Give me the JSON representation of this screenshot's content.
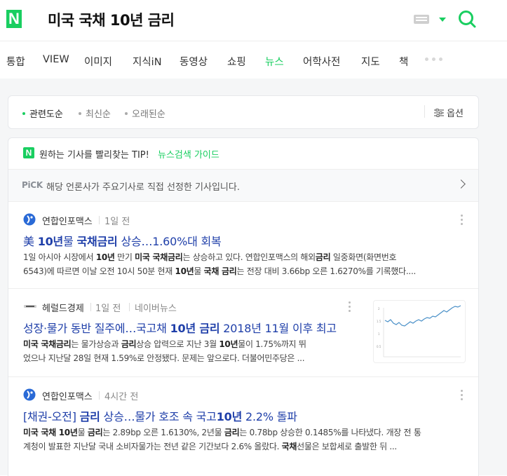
{
  "header": {
    "logo": "N",
    "query": "미국 국채 10년 금리",
    "accent_color": "#19ce60",
    "icons": [
      "keyboard-icon",
      "chevron-down-icon",
      "search-icon"
    ]
  },
  "tabs": [
    {
      "label": "통합",
      "active": false
    },
    {
      "label": "VIEW",
      "active": false
    },
    {
      "label": "이미지",
      "active": false
    },
    {
      "label": "지식iN",
      "active": false
    },
    {
      "label": "동영상",
      "active": false
    },
    {
      "label": "쇼핑",
      "active": false
    },
    {
      "label": "뉴스",
      "active": true
    },
    {
      "label": "어학사전",
      "active": false
    },
    {
      "label": "지도",
      "active": false
    },
    {
      "label": "책",
      "active": false
    }
  ],
  "sort": {
    "options": [
      "관련도순",
      "최신순",
      "오래된순"
    ],
    "active": "관련도순",
    "options_label": "옵션"
  },
  "tip": {
    "logo": "N",
    "text": "원하는 기사를 빨리찾는 TIP!",
    "link": "뉴스검색 가이드"
  },
  "pick": {
    "badge": "PiCK",
    "text": "해당 언론사가 주요기사로 직접 선정한 기사입니다."
  },
  "news": [
    {
      "press": "연합인포맥스",
      "time": "1일 전",
      "headline_parts": [
        "美 ",
        "10년",
        "물 ",
        "국채금리",
        " 상승…1.60%대 회복"
      ],
      "snippet_line1_parts": [
        "1일 아시아 시장에서 ",
        "10년",
        " 만기 ",
        "미국 국채금리",
        "는 상승하고 있다. 연합인포맥스의 해외",
        "금리",
        " 일중화면(화면번호"
      ],
      "snippet_line2_parts": [
        "6543)에 따르면 이날 오전 10시 50분 현재 ",
        "10년",
        "물 ",
        "국채 금리",
        "는 전장 대비 3.66bp 오른 1.6270%를 기록했다...."
      ]
    },
    {
      "press": "헤럴드경제",
      "time": "1일 전",
      "extra": "네이버뉴스",
      "headline_parts": [
        "성장·물가 동반 질주에…국고채 ",
        "10년 금리",
        " 2018년 11월 이후 최고"
      ],
      "snippet_line1_parts": [
        "미국 국채금리",
        "는 물가상승과 ",
        "금리",
        "상승 압력으로 지난 3월 ",
        "10년",
        "물이 1.75%까지 뛰"
      ],
      "snippet_line2_parts": [
        "었으나 지난달 28일 현재 1.59%로 안정됐다. 문제는 앞으로다. 더불어민주당은 ..."
      ]
    },
    {
      "press": "연합인포맥스",
      "time": "4시간 전",
      "headline_parts": [
        "[채권-오전] ",
        "금리",
        " 상승…물가 호조 속 국고",
        "10년",
        " 2.2% 돌파"
      ],
      "snippet_line1_parts": [
        "미국 국채 10년",
        "물 ",
        "금리",
        "는 2.89bp 오른 1.6130%, 2년물 ",
        "금리",
        "는 0.78bp 상승한 0.1485%를 나타냈다. 개장 전 통"
      ],
      "snippet_line2_parts": [
        "계청이 발표한 지난달 국내 소비자물가는 전년 같은 기간보다 2.6% 올랐다. ",
        "국채",
        "선물은 보합세로 출발한 뒤 ..."
      ]
    }
  ]
}
